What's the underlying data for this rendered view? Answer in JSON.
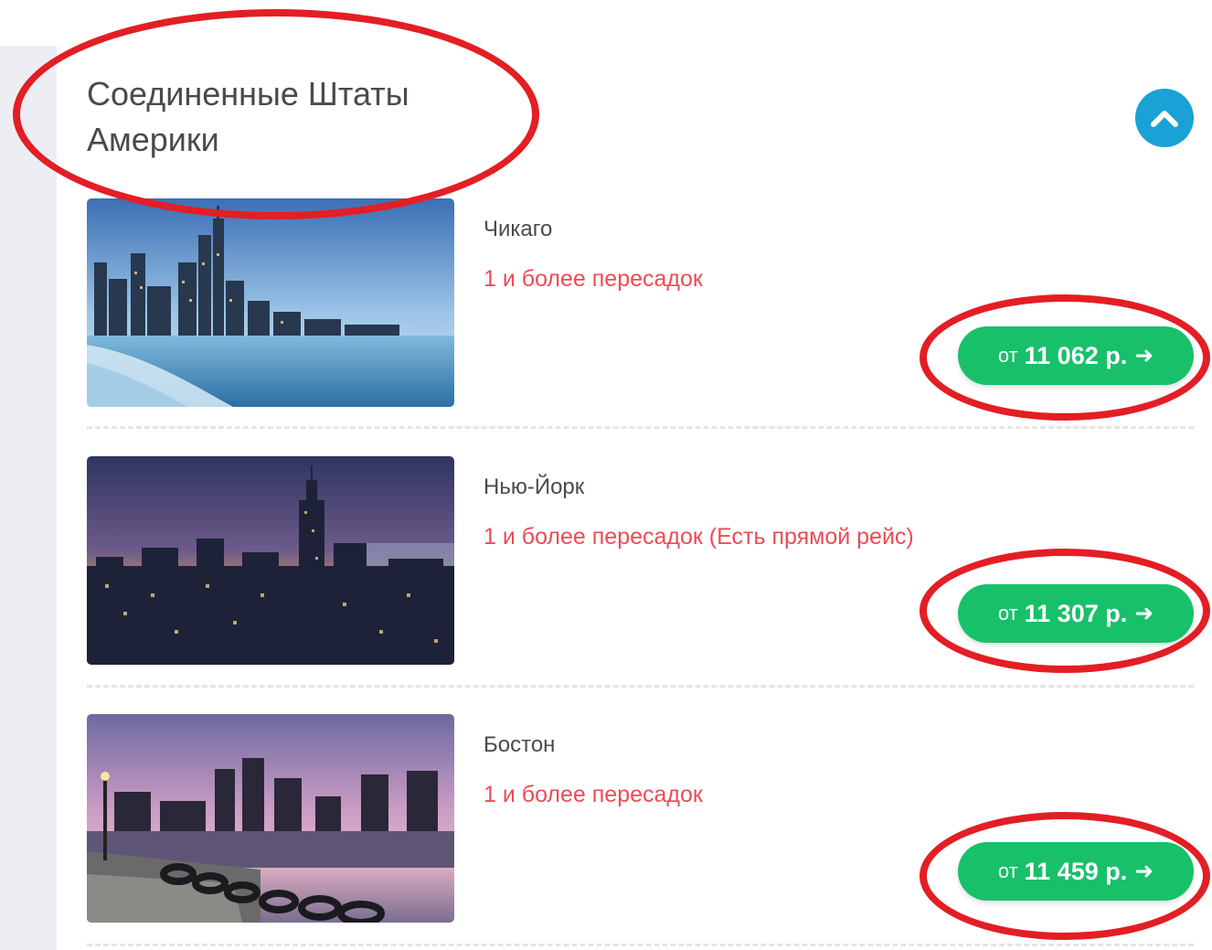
{
  "section": {
    "country": "Соединенные Штаты Америки",
    "accent_color": "#1aa1d6",
    "collapse_icon": "chevron-up-icon"
  },
  "cities": [
    {
      "name": "Чикаго",
      "transfers": "1 и более пересадок",
      "price": {
        "prefix": "от",
        "value": "11 062 р.",
        "arrow": "➜"
      }
    },
    {
      "name": "Нью-Йорк",
      "transfers": "1 и более пересадок (Есть прямой рейс)",
      "price": {
        "prefix": "от",
        "value": "11 307 р.",
        "arrow": "➜"
      }
    },
    {
      "name": "Бостон",
      "transfers": "1 и более пересадок",
      "price": {
        "prefix": "от",
        "value": "11 459 р.",
        "arrow": "➜"
      }
    }
  ],
  "colors": {
    "price_button": "#18c06a",
    "transfers_text": "#ee4b55",
    "annotation": "#e31e24"
  }
}
